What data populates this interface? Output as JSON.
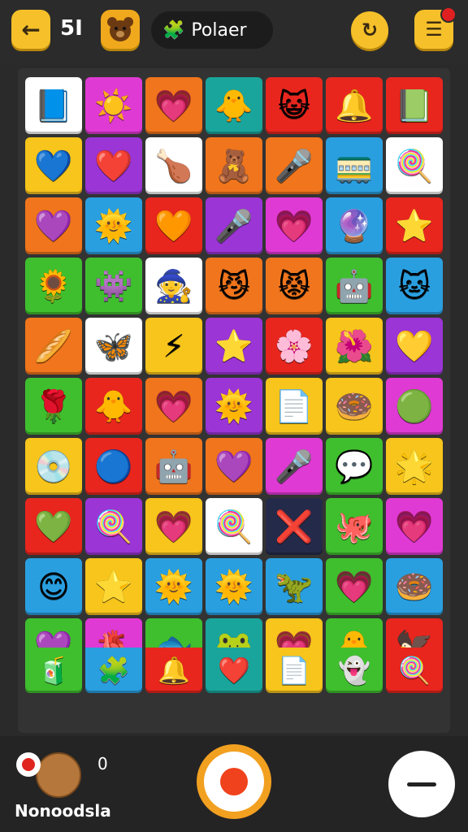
{
  "header": {
    "back_icon": "arrow-left-icon",
    "level": "5I",
    "bear_icon": "bear-face-icon",
    "player_label": "Polaer",
    "player_icon": "puzzle-icon",
    "refresh_icon": "refresh-icon",
    "menu_icon": "menu-icon"
  },
  "colors": {
    "red": "#e8261e",
    "orange": "#f0751c",
    "yellow": "#f7c51b",
    "green": "#3fbf2e",
    "blue": "#2a9fe0",
    "purple": "#9b35d6",
    "magenta": "#e03ad4",
    "white": "#ffffff",
    "teal": "#1aa59c",
    "navy": "#242a4a"
  },
  "board": {
    "rows": [
      [
        [
          "white",
          "📘"
        ],
        [
          "magenta",
          "☀️"
        ],
        [
          "orange",
          "💗"
        ],
        [
          "teal",
          "🐥"
        ],
        [
          "red",
          "😺"
        ],
        [
          "red",
          "🔔"
        ],
        [
          "red",
          "📗"
        ]
      ],
      [
        [
          "yellow",
          "💙"
        ],
        [
          "purple",
          "❤️"
        ],
        [
          "white",
          "🍗"
        ],
        [
          "orange",
          "🧸"
        ],
        [
          "orange",
          "🎤"
        ],
        [
          "blue",
          "🚃"
        ],
        [
          "white",
          "🍭"
        ]
      ],
      [
        [
          "orange",
          "💜"
        ],
        [
          "blue",
          "🌞"
        ],
        [
          "red",
          "🧡"
        ],
        [
          "purple",
          "🎤"
        ],
        [
          "magenta",
          "💗"
        ],
        [
          "blue",
          "🔮"
        ],
        [
          "red",
          "⭐"
        ]
      ],
      [
        [
          "green",
          "🌻"
        ],
        [
          "green",
          "👾"
        ],
        [
          "white",
          "🧙"
        ],
        [
          "orange",
          "😼"
        ],
        [
          "orange",
          "😾"
        ],
        [
          "green",
          "🤖"
        ],
        [
          "blue",
          "🐱"
        ]
      ],
      [
        [
          "orange",
          "🥖"
        ],
        [
          "white",
          "🦋"
        ],
        [
          "yellow",
          "⚡"
        ],
        [
          "purple",
          "⭐"
        ],
        [
          "red",
          "🌸"
        ],
        [
          "yellow",
          "🌺"
        ],
        [
          "purple",
          "💛"
        ]
      ],
      [
        [
          "green",
          "🌹"
        ],
        [
          "red",
          "🐥"
        ],
        [
          "orange",
          "💗"
        ],
        [
          "purple",
          "🌞"
        ],
        [
          "yellow",
          "📄"
        ],
        [
          "yellow",
          "🍩"
        ],
        [
          "magenta",
          "🟢"
        ]
      ],
      [
        [
          "yellow",
          "💿"
        ],
        [
          "red",
          "🔵"
        ],
        [
          "orange",
          "🤖"
        ],
        [
          "orange",
          "💜"
        ],
        [
          "magenta",
          "🎤"
        ],
        [
          "green",
          "💬"
        ],
        [
          "yellow",
          "🌟"
        ]
      ],
      [
        [
          "red",
          "💚"
        ],
        [
          "purple",
          "🍭"
        ],
        [
          "yellow",
          "💗"
        ],
        [
          "white",
          "🍭"
        ],
        [
          "navy",
          "❌"
        ],
        [
          "green",
          "🐙"
        ],
        [
          "magenta",
          "💗"
        ]
      ],
      [
        [
          "blue",
          "😊"
        ],
        [
          "yellow",
          "⭐"
        ],
        [
          "blue",
          "🌞"
        ],
        [
          "blue",
          "🌞"
        ],
        [
          "blue",
          "🦖"
        ],
        [
          "green",
          "💗"
        ],
        [
          "blue",
          "🍩"
        ]
      ],
      [
        [
          "green",
          "💜"
        ],
        [
          "magenta",
          "🫀"
        ],
        [
          "green",
          "🐟"
        ],
        [
          "teal",
          "🐸"
        ],
        [
          "yellow",
          "💗"
        ],
        [
          "green",
          "🐥"
        ],
        [
          "red",
          "🦅"
        ]
      ]
    ],
    "bottom_halves": [
      [
        [
          "green",
          "🧃"
        ],
        [
          "blue",
          "🧩"
        ],
        [
          "red",
          "🔔"
        ],
        [
          "teal",
          "❤️"
        ],
        [
          "yellow",
          "📄"
        ],
        [
          "green",
          "👻"
        ],
        [
          "red",
          "🍭"
        ]
      ]
    ]
  },
  "footer": {
    "player_name": "Nonoodsla",
    "score": "0",
    "avatar_icon": "bear-avatar-icon",
    "record_icon": "record-icon",
    "action_icon": "action-button-icon",
    "minimize_icon": "minus-icon"
  }
}
